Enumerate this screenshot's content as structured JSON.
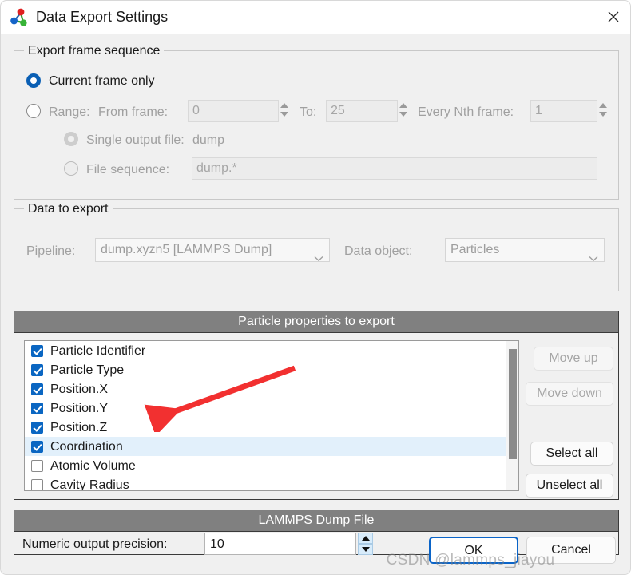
{
  "window": {
    "title": "Data Export Settings",
    "icon": "ovito-molecule-icon",
    "close_label": "×"
  },
  "frames_group": {
    "title": "Export frame sequence",
    "current_frame_label": "Current frame only",
    "current_frame_selected": true,
    "range_label": "Range:",
    "from_frame_label": "From frame:",
    "from_frame_value": "0",
    "to_label": "To:",
    "to_value": "25",
    "every_nth_label": "Every Nth frame:",
    "every_nth_value": "1",
    "single_output_label": "Single output file:",
    "single_output_value": "dump",
    "file_sequence_label": "File sequence:",
    "file_sequence_value": "dump.*"
  },
  "data_group": {
    "title": "Data to export",
    "pipeline_label": "Pipeline:",
    "pipeline_value": "dump.xyzn5 [LAMMPS Dump]",
    "data_object_label": "Data object:",
    "data_object_value": "Particles"
  },
  "properties_panel": {
    "header": "Particle properties to export",
    "items": [
      {
        "label": "Particle Identifier",
        "checked": true,
        "selected": false
      },
      {
        "label": "Particle Type",
        "checked": true,
        "selected": false
      },
      {
        "label": "Position.X",
        "checked": true,
        "selected": false
      },
      {
        "label": "Position.Y",
        "checked": true,
        "selected": false
      },
      {
        "label": "Position.Z",
        "checked": true,
        "selected": false
      },
      {
        "label": "Coordination",
        "checked": true,
        "selected": true
      },
      {
        "label": "Atomic Volume",
        "checked": false,
        "selected": false
      },
      {
        "label": "Cavity Radius",
        "checked": false,
        "selected": false
      }
    ],
    "buttons": {
      "move_up": "Move up",
      "move_down": "Move down",
      "select_all": "Select all",
      "unselect_all": "Unselect all"
    }
  },
  "dump_panel": {
    "header": "LAMMPS Dump File",
    "precision_label": "Numeric output precision:",
    "precision_value": "10"
  },
  "footer": {
    "ok_label": "OK",
    "cancel_label": "Cancel"
  },
  "watermark": {
    "text": "CSDN @lammps_jiayou"
  },
  "colors": {
    "accent": "#0a5fb4",
    "checkbox": "#0a66c2",
    "panel_header": "#808080",
    "selection": "#e2f0fb",
    "annotation_arrow": "#f23030"
  }
}
